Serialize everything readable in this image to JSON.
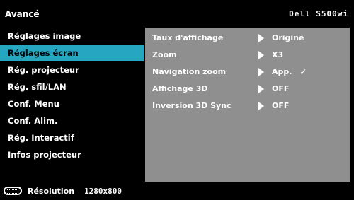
{
  "header": {
    "title": "Avancé",
    "model": "Dell S500wi"
  },
  "sidebar": {
    "items": [
      {
        "label": "Réglages image"
      },
      {
        "label": "Réglages écran"
      },
      {
        "label": "Rég. projecteur"
      },
      {
        "label": "Rég. sfil/LAN"
      },
      {
        "label": "Conf. Menu"
      },
      {
        "label": "Conf. Alim."
      },
      {
        "label": "Rég. Interactif"
      },
      {
        "label": "Infos projecteur"
      }
    ],
    "active_index": 1
  },
  "settings": [
    {
      "label": "Taux d'affichage",
      "value": "Origine"
    },
    {
      "label": "Zoom",
      "value": "X3"
    },
    {
      "label": "Navigation zoom",
      "value": "App.",
      "check": "✓"
    },
    {
      "label": "Affichage 3D",
      "value": "OFF"
    },
    {
      "label": "Inversion 3D Sync",
      "value": "OFF"
    }
  ],
  "footer": {
    "icon": "display-icon",
    "resolution_label": "Résolution",
    "resolution_value": "1280x800"
  },
  "colors": {
    "accent": "#27a6c2",
    "panel": "#8f8f8f",
    "background": "#000000"
  }
}
